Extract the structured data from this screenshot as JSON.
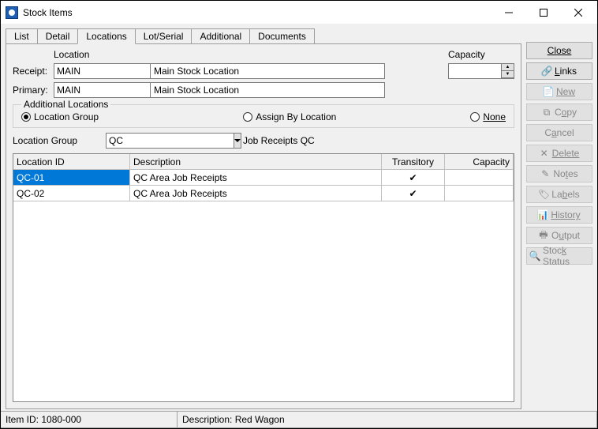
{
  "window": {
    "title": "Stock Items"
  },
  "tabs": [
    "List",
    "Detail",
    "Locations",
    "Lot/Serial",
    "Additional",
    "Documents"
  ],
  "active_tab": "Locations",
  "headings": {
    "location": "Location",
    "capacity": "Capacity"
  },
  "receipt": {
    "label": "Receipt:",
    "value": "MAIN",
    "desc": "Main Stock Location"
  },
  "primary": {
    "label": "Primary:",
    "value": "MAIN",
    "desc": "Main Stock Location"
  },
  "capacity_value": "",
  "additional": {
    "legend": "Additional Locations",
    "options": {
      "group": "Location Group",
      "assign": "Assign By Location",
      "none": "None"
    },
    "selected": "group"
  },
  "location_group": {
    "label": "Location Group",
    "value": "QC",
    "desc": "Job Receipts QC"
  },
  "grid": {
    "columns": {
      "id": "Location ID",
      "desc": "Description",
      "trans": "Transitory",
      "cap": "Capacity"
    },
    "rows": [
      {
        "id": "QC-01",
        "desc": "QC Area Job Receipts",
        "transitory": true,
        "capacity": "",
        "selected": true
      },
      {
        "id": "QC-02",
        "desc": "QC Area Job Receipts",
        "transitory": true,
        "capacity": "",
        "selected": false
      }
    ]
  },
  "sidebar": {
    "close": "Close",
    "links": "Links",
    "new": "New",
    "copy": "Copy",
    "cancel": "Cancel",
    "delete": "Delete",
    "notes": "Notes",
    "labels": "Labels",
    "history": "History",
    "output": "Output",
    "stock_status": "Stock Status"
  },
  "status": {
    "item_id": "Item ID: 1080-000",
    "description": "Description: Red Wagon"
  }
}
